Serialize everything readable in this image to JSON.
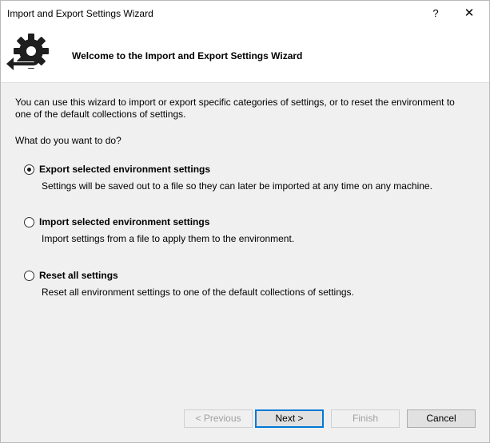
{
  "window": {
    "title": "Import and Export Settings Wizard",
    "help_glyph": "?",
    "close_glyph": "✕"
  },
  "header": {
    "title": "Welcome to the Import and Export Settings Wizard",
    "icon": "gear-arrow-icon"
  },
  "content": {
    "intro": "You can use this wizard to import or export specific categories of settings, or to reset the environment to one of the default collections of settings.",
    "question": "What do you want to do?",
    "options": [
      {
        "label": "Export selected environment settings",
        "description": "Settings will be saved out to a file so they can later be imported at any time on any machine.",
        "selected": true
      },
      {
        "label": "Import selected environment settings",
        "description": "Import settings from a file to apply them to the environment.",
        "selected": false
      },
      {
        "label": "Reset all settings",
        "description": "Reset all environment settings to one of the default collections of settings.",
        "selected": false
      }
    ]
  },
  "buttons": {
    "previous": "< Previous",
    "next": "Next >",
    "finish": "Finish",
    "cancel": "Cancel"
  },
  "colors": {
    "accent": "#0078d7",
    "dialog_background": "#f0f0f0",
    "header_background": "#ffffff"
  }
}
